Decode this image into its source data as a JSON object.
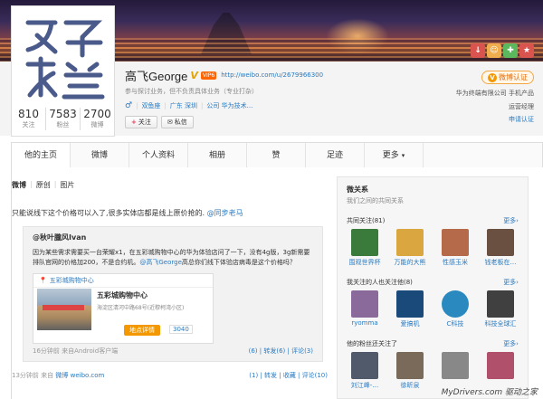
{
  "profile": {
    "name": "高飞George",
    "v_badge": "V",
    "vip": "VIP6",
    "url": "http://weibo.com/u/2679966300",
    "intro": "参与探讨业务，但不负责具体业务（专业打杂）",
    "gender_icon": "male-icon",
    "tags": [
      "双鱼座",
      "广东 深圳",
      "公司 华为技术..."
    ],
    "follow_label": "关注",
    "message_label": "私信"
  },
  "stats": [
    {
      "value": "810",
      "label": "关注"
    },
    {
      "value": "7583",
      "label": "粉丝"
    },
    {
      "value": "2700",
      "label": "微博"
    }
  ],
  "right_info": {
    "verify_label": "微博认证",
    "company": "华为终端有限公司 手机产品",
    "title": "运营经理",
    "apply": "申请认证"
  },
  "cover_icons": [
    {
      "name": "download-icon",
      "glyph": "↓",
      "color": "#d9534f"
    },
    {
      "name": "smile-icon",
      "glyph": "☺",
      "color": "#f0ad4e"
    },
    {
      "name": "gift-icon",
      "glyph": "✚",
      "color": "#5cb85c"
    },
    {
      "name": "tag-icon",
      "glyph": "★",
      "color": "#d9534f"
    }
  ],
  "tabs": [
    "他的主页",
    "微博",
    "个人资料",
    "相册",
    "赞",
    "足迹",
    "更多"
  ],
  "sub_tabs": [
    "微博",
    "原创",
    "图片"
  ],
  "post": {
    "text": "只能说线下这个价格可以入了,很多实体店都是线上原价抢的.",
    "mention": "@同步老马",
    "quote": {
      "author": "@秋叶朧风Ivan",
      "text_pre": "因为某些需求需要买一台荣耀x1，在五彩城购物中心的华为体验店问了一下，没有4g版，3g新需要排队官网的价格加200，不是合约机。",
      "mention": "@高飞George",
      "text_post": "高总你们线下体验店病毒是这个价格吗？",
      "location_head": "五彩城购物中心",
      "location_title": "五彩城购物中心",
      "location_addr": "海淀区清河中路68号(近穆柯湾小区)",
      "location_btn": "地点详情",
      "location_count": "3040",
      "time": "16分钟前 来自Android客户端",
      "acts": "(6) | 转发(6) | 评论(3)"
    },
    "time": "13分钟前",
    "from_label": "来自",
    "source": "微博 weibo.com",
    "acts": "(1) | 转发 | 收藏 | 评论(10)"
  },
  "sidebar": {
    "title": "微关系",
    "subtitle": "我们之间的共同关系",
    "sections": [
      {
        "title": "共同关注(81)",
        "more": "更多›",
        "users": [
          {
            "name": "围观世界杯",
            "color": "#3a7a3a"
          },
          {
            "name": "万能的大熊",
            "color": "#d9a640"
          },
          {
            "name": "性感玉米",
            "color": "#b56a4a"
          },
          {
            "name": "钱老板在…",
            "color": "#6a5040"
          }
        ]
      },
      {
        "title": "我关注的人也关注他(8)",
        "more": "更多›",
        "users": [
          {
            "name": "ryomma",
            "color": "#8a6a9a"
          },
          {
            "name": "爱搞机",
            "color": "#1a4a7a"
          },
          {
            "name": "C科技",
            "color": "#2a8ac0"
          },
          {
            "name": "科技全球汇",
            "color": "#404040"
          }
        ]
      },
      {
        "title": "他的粉丝还关注了",
        "more": "更多›",
        "users": [
          {
            "name": "刘江峰-…",
            "color": "#505a6a"
          },
          {
            "name": "徐昕泉",
            "color": "#7a6a5a"
          },
          {
            "name": "",
            "color": "#888888"
          },
          {
            "name": "",
            "color": "#b0506a"
          }
        ]
      }
    ]
  },
  "watermark": "MyDrivers.com 驱动之家"
}
